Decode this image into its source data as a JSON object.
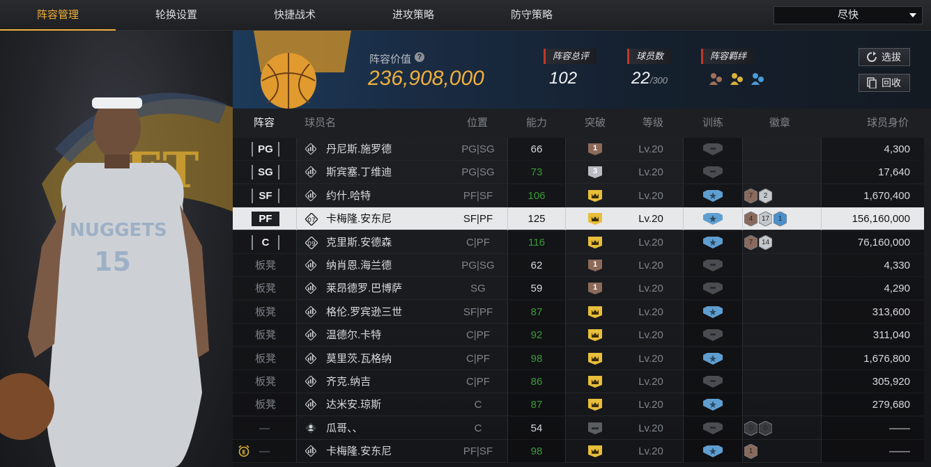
{
  "tabs": [
    {
      "label": "阵容管理",
      "active": true
    },
    {
      "label": "轮换设置",
      "active": false
    },
    {
      "label": "快捷战术",
      "active": false
    },
    {
      "label": "进攻策略",
      "active": false
    },
    {
      "label": "防守策略",
      "active": false
    }
  ],
  "pace_select": {
    "value": "尽快"
  },
  "header": {
    "value_label": "阵容价值",
    "value": "236,908,000",
    "rating_label": "阵容总评",
    "rating": "102",
    "players_label": "球员数",
    "players": "22",
    "players_max": "/300",
    "bond_label": "阵容羁绊",
    "scout_button": "选拔",
    "recycle_button": "回收"
  },
  "columns": {
    "lineup": "阵容",
    "name": "球员名",
    "position": "位置",
    "ability": "能力",
    "breakthrough": "突破",
    "level": "等级",
    "training": "训练",
    "badge": "徽章",
    "price": "球员身价"
  },
  "colors": {
    "accent": "#f0b13a",
    "green": "#3a9a3a",
    "tag_red": "#c0392b"
  },
  "rows": [
    {
      "slot": "PG",
      "slot_type": "start",
      "name": "丹尼斯.施罗德",
      "position": "PG|SG",
      "ability": "66",
      "ability_green": false,
      "break": "1",
      "break_type": "bronze",
      "level": "Lv.20",
      "training": "gray",
      "badges": [],
      "price": "4,300",
      "selected": false,
      "icon": "bars"
    },
    {
      "slot": "SG",
      "slot_type": "start",
      "name": "斯宾塞.丁维迪",
      "position": "PG|SG",
      "ability": "73",
      "ability_green": true,
      "break": "3",
      "break_type": "silver",
      "level": "Lv.20",
      "training": "gray",
      "badges": [],
      "price": "17,640",
      "selected": false,
      "icon": "bars"
    },
    {
      "slot": "SF",
      "slot_type": "start",
      "name": "约什.哈特",
      "position": "PF|SF",
      "ability": "106",
      "ability_green": true,
      "break": "",
      "break_type": "gold",
      "level": "Lv.20",
      "training": "blue",
      "badges": [
        {
          "n": "7",
          "t": "bronze"
        },
        {
          "n": "2",
          "t": "silver"
        }
      ],
      "price": "1,670,400",
      "selected": false,
      "icon": "bars"
    },
    {
      "slot": "PF",
      "slot_type": "start",
      "name": "卡梅隆.安东尼",
      "position": "SF|PF",
      "ability": "125",
      "ability_green": false,
      "break": "",
      "break_type": "gold",
      "level": "Lv.20",
      "training": "blue",
      "badges": [
        {
          "n": "4",
          "t": "bronze"
        },
        {
          "n": "17",
          "t": "silver"
        },
        {
          "n": "1",
          "t": "blue"
        }
      ],
      "price": "156,160,000",
      "selected": true,
      "icon": "07"
    },
    {
      "slot": "C",
      "slot_type": "start",
      "name": "克里斯.安德森",
      "position": "C|PF",
      "ability": "116",
      "ability_green": true,
      "break": "",
      "break_type": "gold",
      "level": "Lv.20",
      "training": "blue",
      "badges": [
        {
          "n": "7",
          "t": "bronze"
        },
        {
          "n": "14",
          "t": "silver"
        }
      ],
      "price": "76,160,000",
      "selected": false,
      "icon": "09"
    },
    {
      "slot": "板凳",
      "slot_type": "bench",
      "name": "纳肖恩.海兰德",
      "position": "PG|SG",
      "ability": "62",
      "ability_green": false,
      "break": "1",
      "break_type": "bronze",
      "level": "Lv.20",
      "training": "gray",
      "badges": [],
      "price": "4,330",
      "selected": false,
      "icon": "bars"
    },
    {
      "slot": "板凳",
      "slot_type": "bench",
      "name": "莱昂德罗.巴博萨",
      "position": "SG",
      "ability": "59",
      "ability_green": false,
      "break": "1",
      "break_type": "bronze",
      "level": "Lv.20",
      "training": "gray",
      "badges": [],
      "price": "4,290",
      "selected": false,
      "icon": "bars"
    },
    {
      "slot": "板凳",
      "slot_type": "bench",
      "name": "格伦.罗宾逊三世",
      "position": "SF|PF",
      "ability": "87",
      "ability_green": true,
      "break": "",
      "break_type": "gold",
      "level": "Lv.20",
      "training": "blue",
      "badges": [],
      "price": "313,600",
      "selected": false,
      "icon": "bars"
    },
    {
      "slot": "板凳",
      "slot_type": "bench",
      "name": "温德尔.卡特",
      "position": "C|PF",
      "ability": "92",
      "ability_green": true,
      "break": "",
      "break_type": "gold",
      "level": "Lv.20",
      "training": "gray",
      "badges": [],
      "price": "311,040",
      "selected": false,
      "icon": "bars"
    },
    {
      "slot": "板凳",
      "slot_type": "bench",
      "name": "莫里茨.瓦格纳",
      "position": "C|PF",
      "ability": "98",
      "ability_green": true,
      "break": "",
      "break_type": "gold",
      "level": "Lv.20",
      "training": "blue",
      "badges": [],
      "price": "1,676,800",
      "selected": false,
      "icon": "bars"
    },
    {
      "slot": "板凳",
      "slot_type": "bench",
      "name": "齐克.纳吉",
      "position": "C|PF",
      "ability": "86",
      "ability_green": true,
      "break": "",
      "break_type": "gold",
      "level": "Lv.20",
      "training": "gray",
      "badges": [],
      "price": "305,920",
      "selected": false,
      "icon": "bars"
    },
    {
      "slot": "板凳",
      "slot_type": "bench",
      "name": "达米安.琼斯",
      "position": "C",
      "ability": "87",
      "ability_green": true,
      "break": "",
      "break_type": "gold",
      "level": "Lv.20",
      "training": "blue",
      "badges": [],
      "price": "279,680",
      "selected": false,
      "icon": "bars"
    },
    {
      "slot": "—",
      "slot_type": "none",
      "name": "瓜哥、、",
      "position": "C",
      "ability": "54",
      "ability_green": false,
      "break": "",
      "break_type": "none",
      "level": "Lv.20",
      "training": "gray",
      "badges": [
        {
          "n": "0",
          "t": "dark"
        },
        {
          "n": "0",
          "t": "dark"
        }
      ],
      "price": "——",
      "selected": false,
      "icon": "person"
    },
    {
      "slot": "—",
      "slot_type": "none",
      "name": "卡梅隆.安东尼",
      "position": "PF|SF",
      "ability": "98",
      "ability_green": true,
      "break": "",
      "break_type": "gold",
      "level": "Lv.20",
      "training": "blue",
      "badges": [
        {
          "n": "1",
          "t": "bronze"
        }
      ],
      "price": "——",
      "selected": false,
      "icon": "bars",
      "alarm": true
    }
  ]
}
